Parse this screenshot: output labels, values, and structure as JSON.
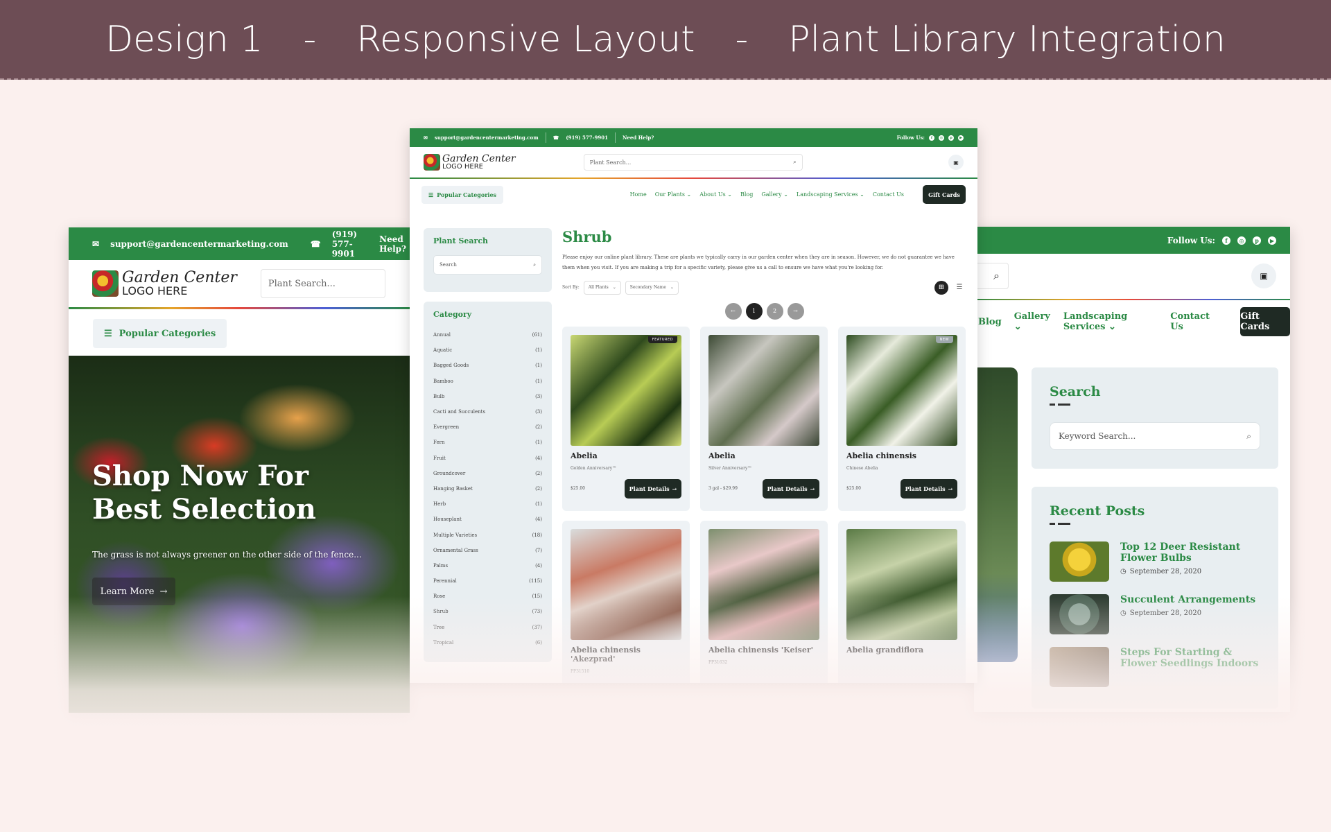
{
  "banner": {
    "part1": "Design 1",
    "dash1": "-",
    "part2": "Responsive Layout",
    "dash2": "-",
    "part3": "Plant Library Integration"
  },
  "colors": {
    "brand_green": "#2b8a45",
    "banner_bg": "#6d4d55",
    "page_bg": "#fbf0ee",
    "dark_button": "#1f2a24"
  },
  "site": {
    "email": "support@gardencentermarketing.com",
    "phone": "(919) 577-9901",
    "help": "Need Help?",
    "follow": "Follow Us:",
    "logo_line1": "Garden Center",
    "logo_line2": "LOGO HERE",
    "search_placeholder": "Plant Search...",
    "popular_categories": "Popular Categories",
    "gift_cards": "Gift Cards",
    "social_icons": [
      "facebook-icon",
      "instagram-icon",
      "pinterest-icon",
      "youtube-icon"
    ]
  },
  "nav": {
    "home": "Home",
    "our_plants": "Our Plants",
    "about_us": "About Us",
    "blog": "Blog",
    "gallery": "Gallery",
    "landscaping": "Landscaping Services",
    "contact": "Contact Us"
  },
  "hero": {
    "title": "Shop Now For Best Selection",
    "subtitle": "The grass is not always greener on the other side of the fence...",
    "button": "Learn More"
  },
  "library": {
    "plant_search_title": "Plant Search",
    "search_placeholder": "Search",
    "category_title": "Category",
    "categories": [
      {
        "name": "Annual",
        "count": "(61)"
      },
      {
        "name": "Aquatic",
        "count": "(1)"
      },
      {
        "name": "Bagged Goods",
        "count": "(1)"
      },
      {
        "name": "Bamboo",
        "count": "(1)"
      },
      {
        "name": "Bulb",
        "count": "(3)"
      },
      {
        "name": "Cacti and Succulents",
        "count": "(3)"
      },
      {
        "name": "Evergreen",
        "count": "(2)"
      },
      {
        "name": "Fern",
        "count": "(1)"
      },
      {
        "name": "Fruit",
        "count": "(4)"
      },
      {
        "name": "Groundcover",
        "count": "(2)"
      },
      {
        "name": "Hanging Basket",
        "count": "(2)"
      },
      {
        "name": "Herb",
        "count": "(1)"
      },
      {
        "name": "Houseplant",
        "count": "(4)"
      },
      {
        "name": "Multiple Varieties",
        "count": "(18)"
      },
      {
        "name": "Ornamental Grass",
        "count": "(7)"
      },
      {
        "name": "Palms",
        "count": "(4)"
      },
      {
        "name": "Perennial",
        "count": "(115)"
      },
      {
        "name": "Rose",
        "count": "(15)"
      },
      {
        "name": "Shrub",
        "count": "(73)"
      },
      {
        "name": "Tree",
        "count": "(37)"
      },
      {
        "name": "Tropical",
        "count": "(6)"
      }
    ],
    "page_title": "Shrub",
    "intro": "Please enjoy our online plant library. These are plants we typically carry in our garden center when they are in season. However, we do not guarantee we have them when you visit. If you are making a trip for a specific variety, please give us a call to ensure we have what you're looking for.",
    "sort_label": "Sort By:",
    "sort_option1": "All Plants",
    "sort_option2": "Secondary Name",
    "pages": [
      "1",
      "2"
    ],
    "details_label": "Plant Details",
    "plants": [
      {
        "name": "Abelia",
        "sub": "Golden Anniversary™",
        "price": "$25.00",
        "badge": "FEATURED",
        "img": "linear-gradient(135deg,#c9d873 0%,#2f4a1d 35%,#b8cc55 55%,#1e3512 80%,#d6e07a 100%)"
      },
      {
        "name": "Abelia",
        "sub": "Silver Anniversary™",
        "price": "3 gal - $29.99",
        "badge": "",
        "img": "linear-gradient(135deg,#3c4a34 0%,#c7c6bf 30%,#5f6e4f 55%,#d5c9c9 75%,#394533 100%)"
      },
      {
        "name": "Abelia chinensis",
        "sub": "Chinese Abelia",
        "price": "$25.00",
        "badge": "NEW",
        "img": "linear-gradient(135deg,#2b4a1e 0%,#e6eadb 25%,#3a5d26 50%,#f1f2e8 70%,#284219 100%)"
      },
      {
        "name": "Abelia chinensis 'Akezprad'",
        "sub": "PP31510",
        "price": "",
        "badge": "",
        "img": "linear-gradient(160deg,#d9dcdc 0%,#c97a64 35%,#e0cfc6 55%,#8a5a48 80%,#d2d4d4 100%)"
      },
      {
        "name": "Abelia chinensis 'Keiser'",
        "sub": "PP31632",
        "price": "",
        "badge": "",
        "img": "linear-gradient(160deg,#7d8f6e 0%,#e8c8c8 30%,#4d5e3e 55%,#d8a8a8 75%,#6a7a5a 100%)"
      },
      {
        "name": "Abelia grandiflora",
        "sub": "",
        "price": "",
        "badge": "",
        "img": "linear-gradient(160deg,#5a7a45 0%,#c6d2a8 35%,#3f5b2f 60%,#b5c496 80%,#4b6a38 100%)"
      }
    ]
  },
  "sidebar": {
    "search_title": "Search",
    "keyword_placeholder": "Keyword Search...",
    "recent_title": "Recent Posts",
    "posts": [
      {
        "title": "Top 12 Deer Resistant Flower Bulbs",
        "date": "September 28, 2020",
        "img": "radial-gradient(circle at 50% 45%,#f4d23b 0 30%,#c9a81c 31% 45%,#5d7a2c 46%)"
      },
      {
        "title": "Succulent Arrangements",
        "date": "September 28, 2020",
        "img": "radial-gradient(circle at 50% 50%,#8fa59a 0 30%,#4f6658 31% 55%,#2f3d32 56%)"
      },
      {
        "title": "Steps For Starting & Flower Seedlings Indoors",
        "date": "",
        "img": "linear-gradient(135deg,#a89278,#5b4a3a)"
      }
    ]
  }
}
